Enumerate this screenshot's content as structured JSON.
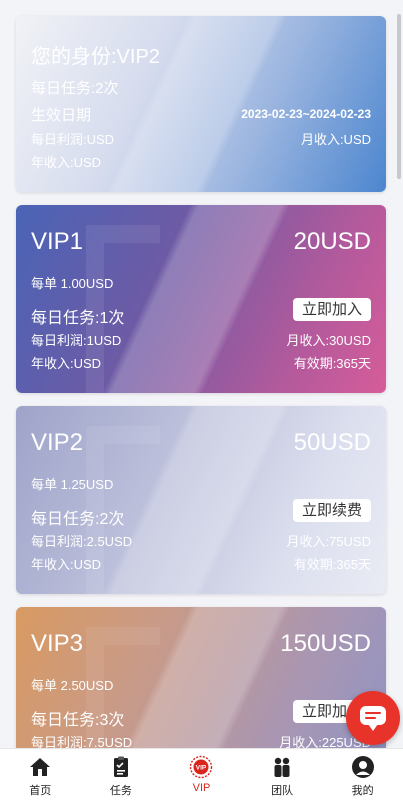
{
  "status": {
    "identity": "您的身份:VIP2",
    "daily_tasks": "每日任务:2次",
    "effective_label": "生效日期",
    "effective_range": "2023-02-23~2024-02-23",
    "daily_profit": "每日利润:USD",
    "monthly_income": "月收入:USD",
    "annual_income": "年收入:USD"
  },
  "tiers": [
    {
      "name": "VIP1",
      "price": "20USD",
      "per_order": "每单 1.00USD",
      "daily_tasks": "每日任务:1次",
      "button": "立即加入",
      "daily_profit": "每日利润:1USD",
      "monthly_income": "月收入:30USD",
      "annual_income": "年收入:USD",
      "validity": "有效期:365天"
    },
    {
      "name": "VIP2",
      "price": "50USD",
      "per_order": "每单 1.25USD",
      "daily_tasks": "每日任务:2次",
      "button": "立即续费",
      "daily_profit": "每日利润:2.5USD",
      "monthly_income": "月收入:75USD",
      "annual_income": "年收入:USD",
      "validity": "有效期:365天"
    },
    {
      "name": "VIP3",
      "price": "150USD",
      "per_order": "每单 2.50USD",
      "daily_tasks": "每日任务:3次",
      "button": "立即加入",
      "daily_profit": "每日利润:7.5USD",
      "monthly_income": "月收入:225USD"
    }
  ],
  "nav": {
    "items": [
      {
        "label": "首页",
        "icon": "home-icon"
      },
      {
        "label": "任务",
        "icon": "task-clipboard-icon"
      },
      {
        "label": "VIP",
        "icon": "vip-badge-icon"
      },
      {
        "label": "团队",
        "icon": "team-icon"
      },
      {
        "label": "我的",
        "icon": "profile-avatar-icon"
      }
    ],
    "active": "VIP",
    "active_color": "#d9261c"
  },
  "chat": {
    "icon": "chat-bubble-icon",
    "color": "#e8332a"
  }
}
